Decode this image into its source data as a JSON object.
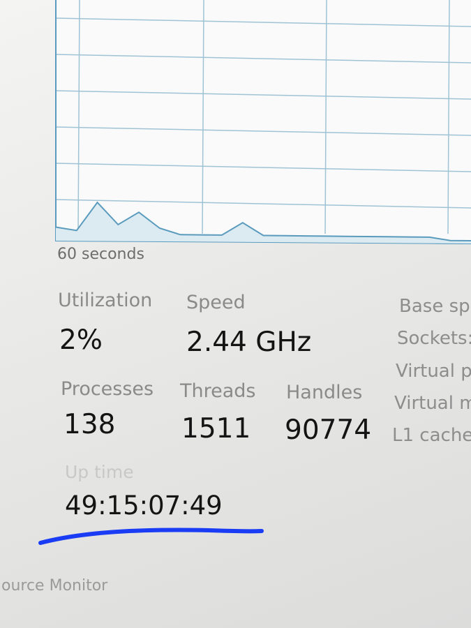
{
  "graph": {
    "time_span_label": "60 seconds",
    "utilization_trace": [
      3,
      2,
      11,
      4,
      8,
      3,
      1,
      1,
      1,
      5,
      1,
      1,
      1,
      1,
      1,
      1,
      1,
      1,
      1,
      0,
      0
    ]
  },
  "stats": {
    "utilization": {
      "label": "Utilization",
      "value": "2%"
    },
    "speed": {
      "label": "Speed",
      "value": "2.44 GHz"
    },
    "processes": {
      "label": "Processes",
      "value": "138"
    },
    "threads": {
      "label": "Threads",
      "value": "1511"
    },
    "handles": {
      "label": "Handles",
      "value": "90774"
    },
    "uptime": {
      "label": "Up time",
      "value": "49:15:07:49"
    }
  },
  "right_column": [
    "Base sp",
    "Sockets:",
    "Virtual p",
    "Virtual m",
    "L1 cache:"
  ],
  "footer": {
    "resource_monitor": "ource Monitor"
  },
  "colors": {
    "grid": "#9fc3d4",
    "trace": "#5a9bbd",
    "trace_fill": "#dcebf2",
    "annotation": "#1a3cf5"
  }
}
